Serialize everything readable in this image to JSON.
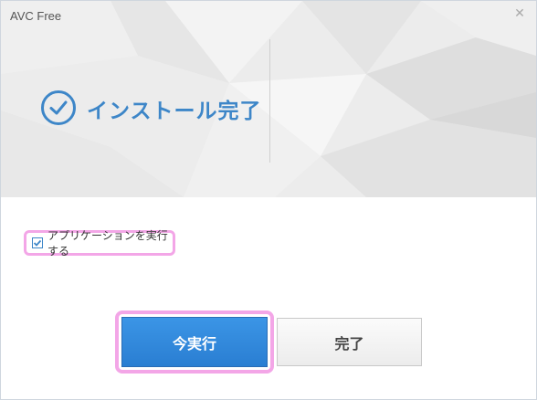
{
  "window": {
    "title": "AVC Free"
  },
  "banner": {
    "headline": "インストール完了"
  },
  "option": {
    "run_app_label": "アプリケーションを実行する",
    "checked": true
  },
  "buttons": {
    "run_now": "今実行",
    "finish": "完了"
  },
  "colors": {
    "accent": "#3d86c8",
    "highlight": "#f3a6e7",
    "primary_button": "#2a7ed2"
  },
  "icons": {
    "close": "close-icon",
    "done": "check-circle-icon",
    "checkbox": "checkbox-checked-icon"
  }
}
